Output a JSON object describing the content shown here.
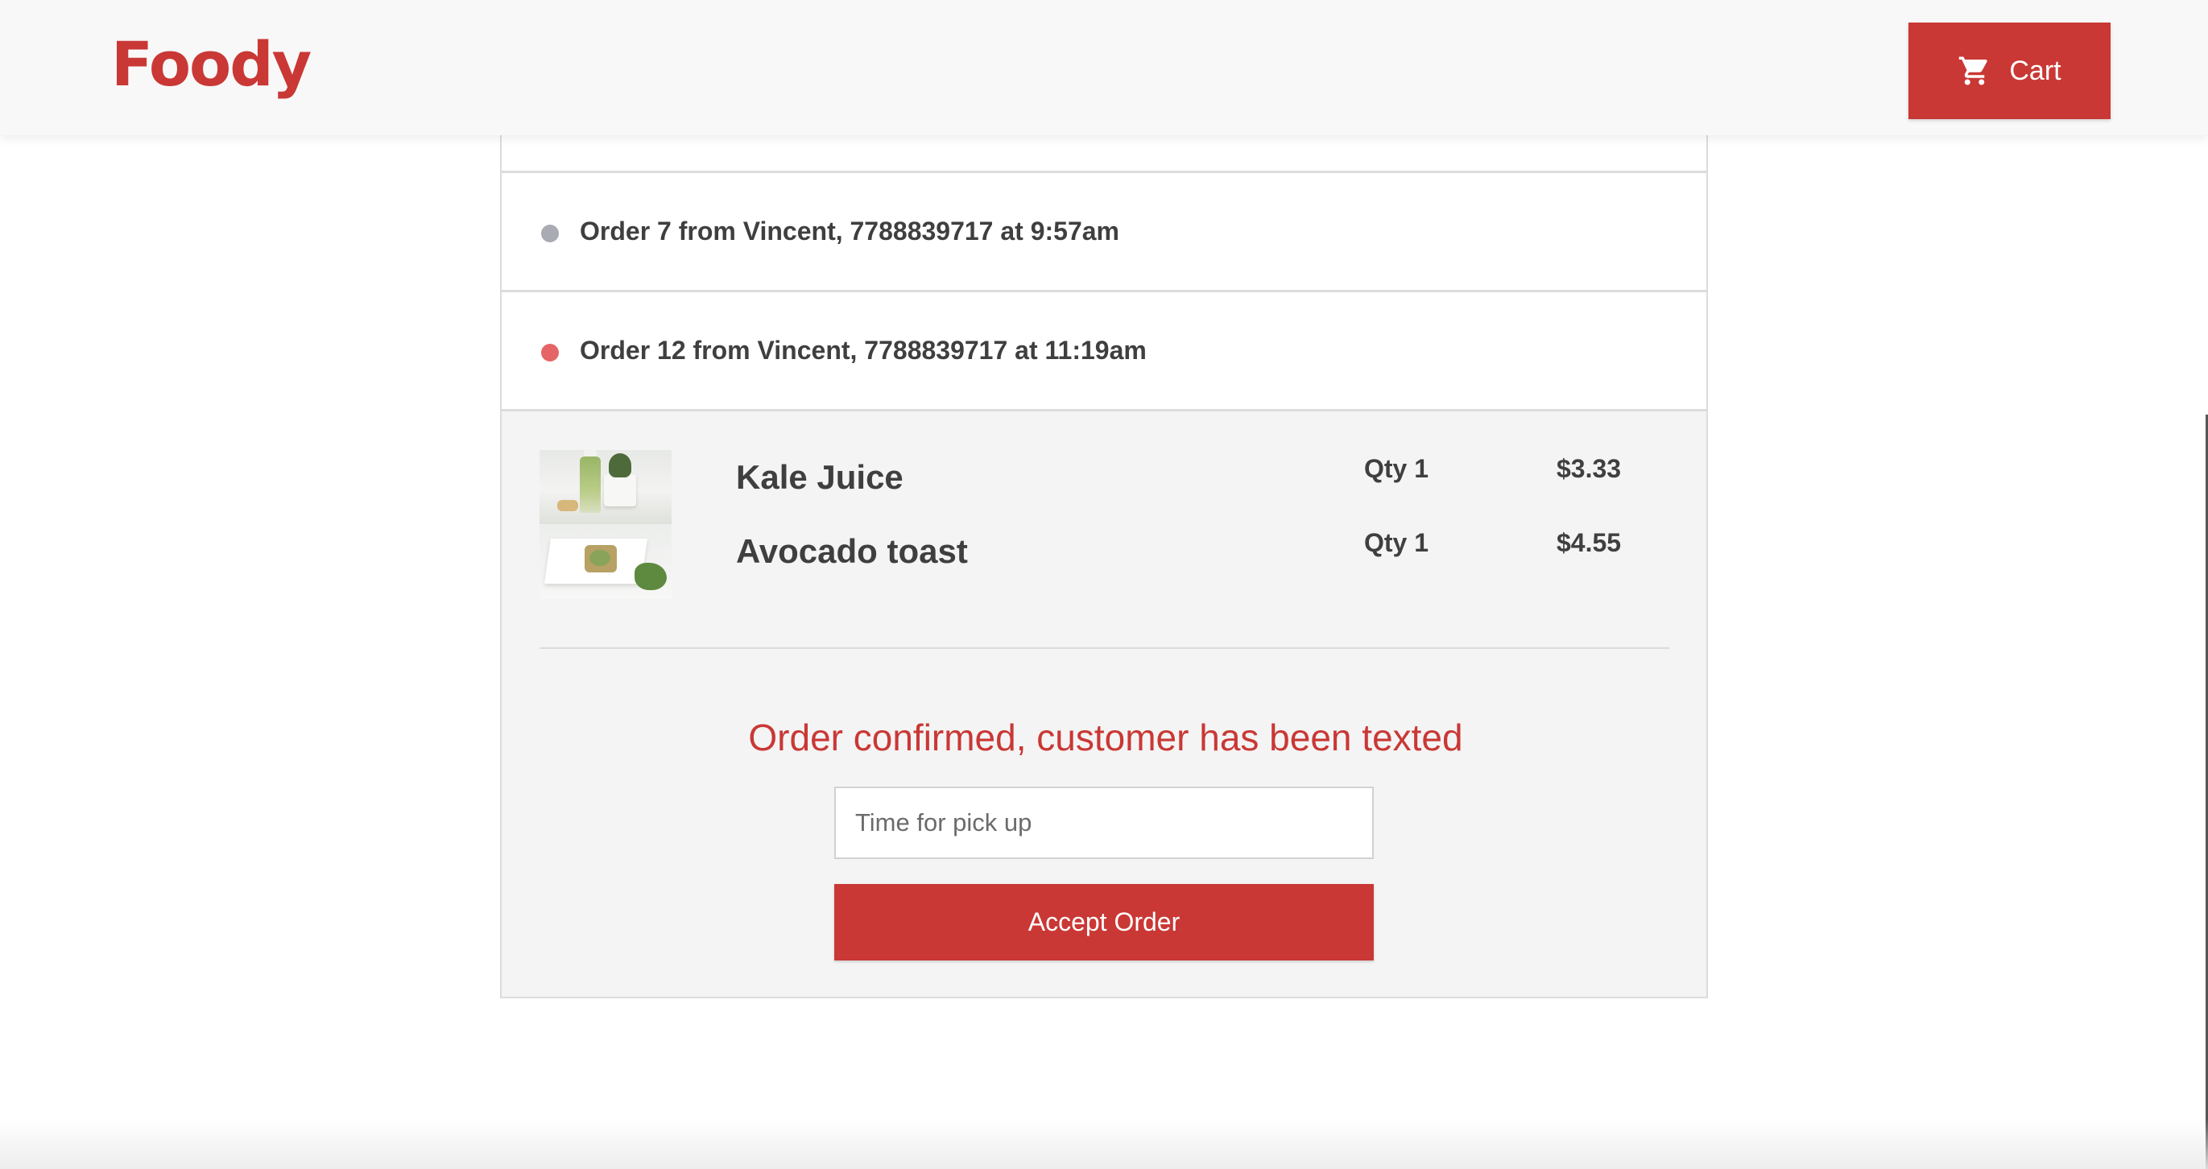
{
  "header": {
    "logo": "Foody",
    "cart_label": "Cart",
    "cart_icon": "shopping-cart-icon"
  },
  "orders": [
    {
      "label": "Order 7 from Vincent, 7788839717 at 9:57am",
      "status_color": "#a8abb2"
    },
    {
      "label": "Order 12 from Vincent, 7788839717 at 11:19am",
      "status_color": "#e56465"
    }
  ],
  "order_detail": {
    "items": [
      {
        "name": "Kale Juice",
        "qty": "Qty 1",
        "price": "$3.33"
      },
      {
        "name": "Avocado toast",
        "qty": "Qty 1",
        "price": "$4.55"
      }
    ],
    "confirmation": "Order confirmed, customer has been texted",
    "pickup_placeholder": "Time for pick up",
    "accept_label": "Accept Order"
  },
  "colors": {
    "accent": "#c93835",
    "header_bg": "#f8f8f8",
    "detail_bg": "#f4f4f4"
  }
}
